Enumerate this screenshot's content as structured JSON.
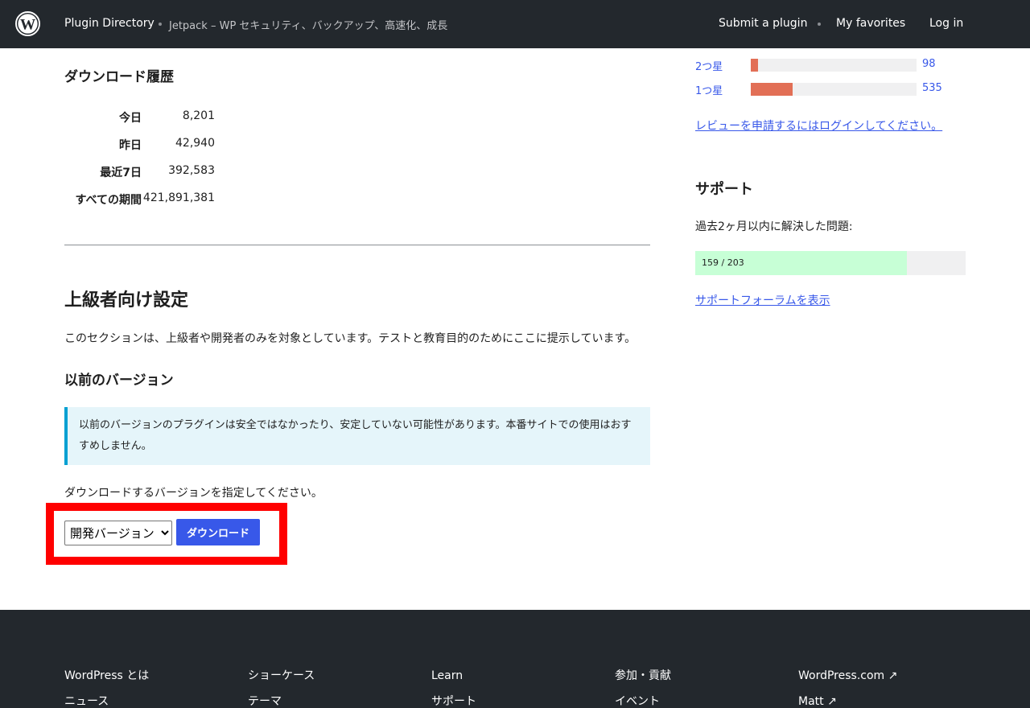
{
  "header": {
    "brand": "Plugin Directory",
    "breadcrumb": "Jetpack – WP セキュリティ、バックアップ、高速化、成長",
    "nav": {
      "submit": "Submit a plugin",
      "favorites": "My favorites",
      "login": "Log in"
    }
  },
  "download_history": {
    "title": "ダウンロード履歴",
    "rows": [
      {
        "label": "今日",
        "value": "8,201"
      },
      {
        "label": "昨日",
        "value": "42,940"
      },
      {
        "label": "最近7日",
        "value": "392,583"
      },
      {
        "label": "すべての期間",
        "value": "421,891,381"
      }
    ]
  },
  "advanced": {
    "title": "上級者向け設定",
    "description": "このセクションは、上級者や開発者のみを対象としています。テストと教育目的のためにここに提示しています。",
    "previous_title": "以前のバージョン",
    "notice": "以前のバージョンのプラグインは安全ではなかったり、安定していない可能性があります。本番サイトでの使用はおすすめしません。",
    "choose_text": "ダウンロードするバージョンを指定してください。",
    "select_value": "開発バージョン",
    "download_label": "ダウンロード"
  },
  "ratings": {
    "rows": [
      {
        "label": "2つ星",
        "count": "98",
        "fraction": 0.045
      },
      {
        "label": "1つ星",
        "count": "535",
        "fraction": 0.25
      }
    ],
    "login_link": "レビューを申請するにはログインしてください。"
  },
  "support": {
    "title": "サポート",
    "description": "過去2ヶ月以内に解決した問題:",
    "resolved_text": "159 / 203",
    "resolved_fraction": 0.783,
    "forum_link": "サポートフォーラムを表示"
  },
  "footer": {
    "columns": [
      [
        "WordPress とは",
        "ニュース"
      ],
      [
        "ショーケース",
        "テーマ"
      ],
      [
        "Learn",
        "サポート"
      ],
      [
        "参加・貢献",
        "イベント"
      ],
      [
        "WordPress.com ↗",
        "Matt ↗"
      ]
    ]
  },
  "colors": {
    "header_bg": "#23282d",
    "accent": "#3858e9",
    "rating_bar": "#e26f56",
    "support_bar": "#c7ffd6",
    "highlight": "#ff0000"
  },
  "icons": {
    "logo": "wordpress-logo-icon"
  }
}
